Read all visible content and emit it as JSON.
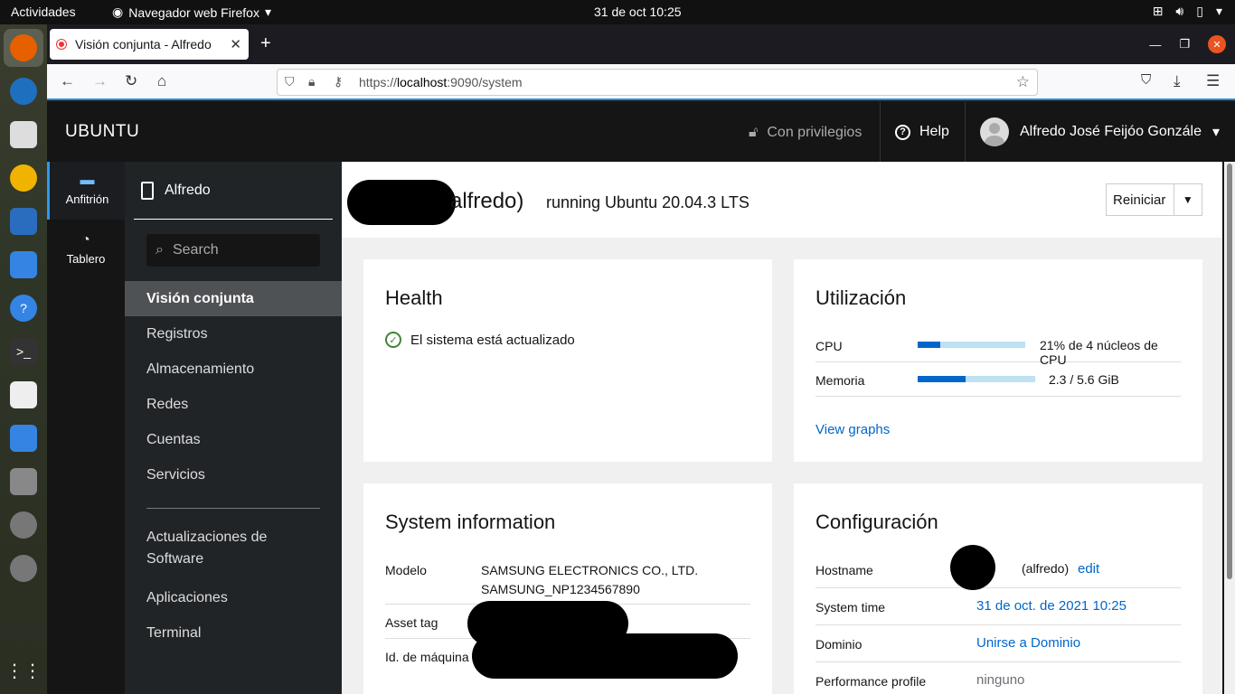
{
  "topbar": {
    "activities": "Actividades",
    "app_name": "Navegador web Firefox",
    "clock": "31 de oct  10:25"
  },
  "browser": {
    "tab_title": "Visión conjunta - Alfredo",
    "url_scheme": "https://",
    "url_host": "localhost",
    "url_rest": ":9090/system"
  },
  "cockpit": {
    "brand": "UBUNTU",
    "privileges": "Con privilegios",
    "help": "Help",
    "user": "Alfredo José Feijóo Gonzále"
  },
  "hostnav": [
    {
      "label": "Anfitrión",
      "icon": "server-icon"
    },
    {
      "label": "Tablero",
      "icon": "dashboard-icon"
    }
  ],
  "sidebar": {
    "host": "Alfredo",
    "search_placeholder": "Search",
    "items": [
      "Visión conjunta",
      "Registros",
      "Almacenamiento",
      "Redes",
      "Cuentas",
      "Servicios"
    ],
    "items2": [
      "Actualizaciones de Software",
      "Aplicaciones",
      "Terminal"
    ]
  },
  "page": {
    "title_visible": "alfredo)",
    "subtitle": "running Ubuntu 20.04.3 LTS",
    "restart": "Reiniciar"
  },
  "health": {
    "title": "Health",
    "status": "El sistema está actualizado"
  },
  "usage": {
    "title": "Utilización",
    "cpu_label": "CPU",
    "cpu_fraction": 0.21,
    "cpu_value": "21% de 4 núcleos de CPU",
    "mem_label": "Memoria",
    "mem_fraction": 0.41,
    "mem_value": "2.3 / 5.6 GiB",
    "link": "View graphs"
  },
  "sysinfo": {
    "title": "System information",
    "model_label": "Modelo",
    "model_line1": "SAMSUNG ELECTRONICS CO., LTD.",
    "model_line2": "SAMSUNG_NP1234567890",
    "asset_label": "Asset tag",
    "machine_label": "Id. de máquina"
  },
  "config": {
    "title": "Configuración",
    "hostname_label": "Hostname",
    "hostname_value": "(alfredo)",
    "hostname_edit": "edit",
    "time_label": "System time",
    "time_value": "31 de oct. de 2021 10:25",
    "domain_label": "Dominio",
    "domain_value": "Unirse a Dominio",
    "perf_label": "Performance profile",
    "perf_value": "ninguno"
  }
}
